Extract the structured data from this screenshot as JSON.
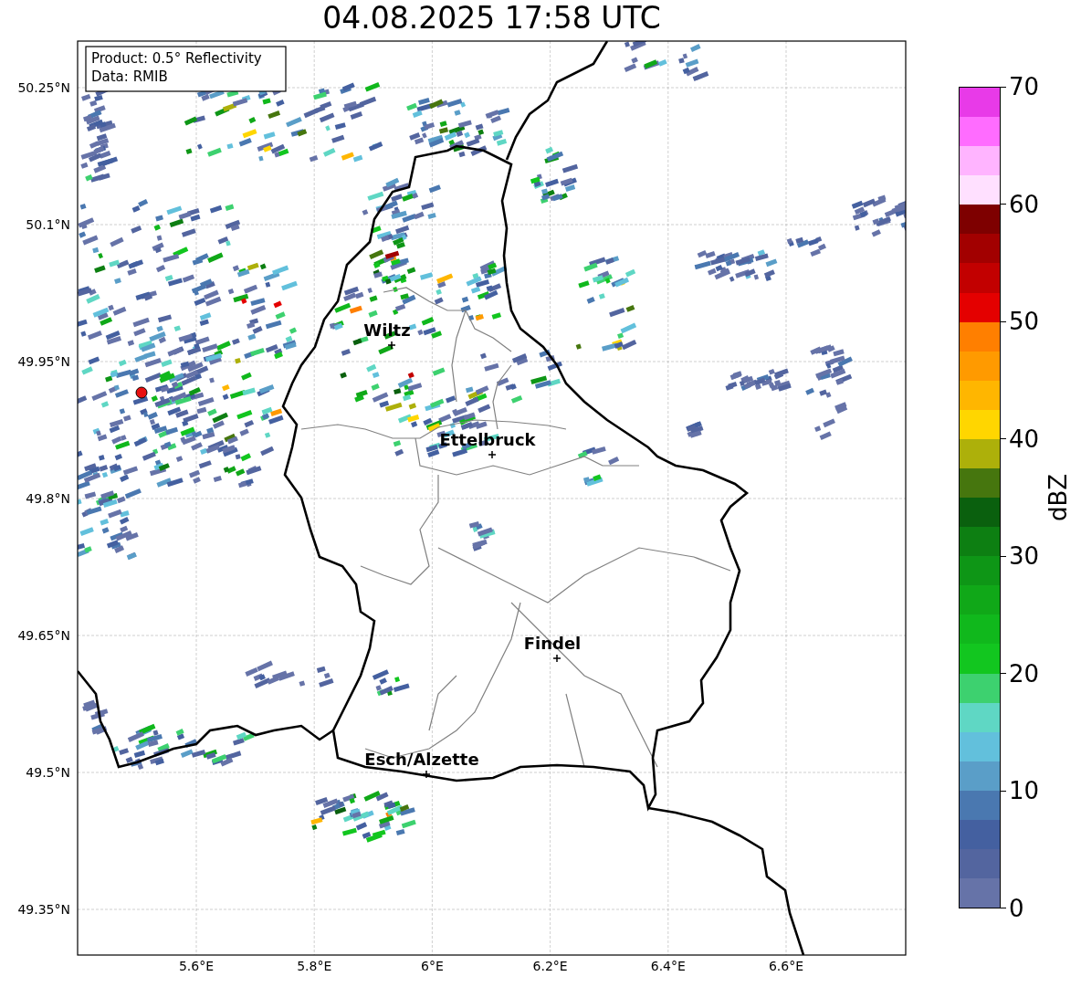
{
  "title": "04.08.2025 17:58 UTC",
  "legend": [
    "Product: 0.5° Reflectivity",
    "Data: RMIB"
  ],
  "x_ticks": [
    "5.6°E",
    "5.8°E",
    "6°E",
    "6.2°E",
    "6.4°E",
    "6.6°E"
  ],
  "y_ticks": [
    "50.25°N",
    "50.1°N",
    "49.95°N",
    "49.8°N",
    "49.65°N",
    "49.5°N",
    "49.35°N"
  ],
  "cities": [
    {
      "name": "Wiltz"
    },
    {
      "name": "Ettelbruck"
    },
    {
      "name": "Findel"
    },
    {
      "name": "Esch/Alzette"
    }
  ],
  "colorbar": {
    "label": "dBZ",
    "ticks": [
      "70",
      "60",
      "50",
      "40",
      "30",
      "20",
      "10",
      "0"
    ],
    "steps": [
      {
        "color": "#e83ae8"
      },
      {
        "color": "#ff6cff"
      },
      {
        "color": "#ffb4ff"
      },
      {
        "color": "#ffe0ff"
      },
      {
        "color": "#7e0000"
      },
      {
        "color": "#a20000"
      },
      {
        "color": "#c20000"
      },
      {
        "color": "#e40000"
      },
      {
        "color": "#ff7f00"
      },
      {
        "color": "#ff9a00"
      },
      {
        "color": "#ffb600"
      },
      {
        "color": "#ffd600"
      },
      {
        "color": "#adb00a"
      },
      {
        "color": "#46760e"
      },
      {
        "color": "#0a600e"
      },
      {
        "color": "#0d7f12"
      },
      {
        "color": "#0e9616"
      },
      {
        "color": "#10a818"
      },
      {
        "color": "#10b81c"
      },
      {
        "color": "#12c61f"
      },
      {
        "color": "#3dd16f"
      },
      {
        "color": "#5fd7c4"
      },
      {
        "color": "#62c0dc"
      },
      {
        "color": "#5a9ec8"
      },
      {
        "color": "#4a78b0"
      },
      {
        "color": "#4460a0"
      },
      {
        "color": "#53659f"
      },
      {
        "color": "#6673a8"
      }
    ]
  }
}
